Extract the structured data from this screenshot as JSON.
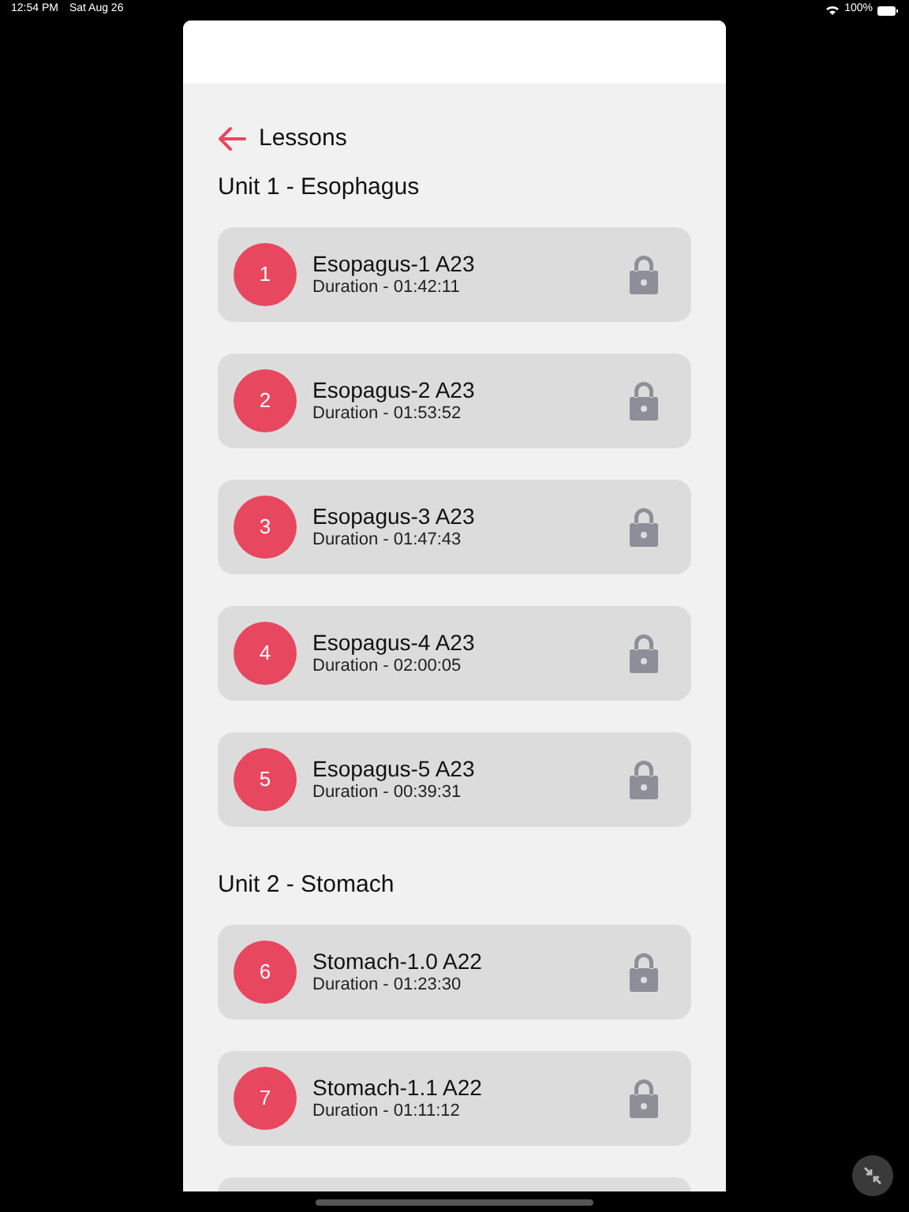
{
  "status_bar": {
    "time": "12:54 PM",
    "date": "Sat Aug 26",
    "battery": "100%"
  },
  "header": {
    "back_label": "Lessons"
  },
  "units": [
    {
      "title": "Unit 1 - Esophagus",
      "lessons": [
        {
          "number": "1",
          "title": "Esopagus-1 A23",
          "duration": "Duration - 01:42:11",
          "locked": true
        },
        {
          "number": "2",
          "title": "Esopagus-2 A23",
          "duration": "Duration - 01:53:52",
          "locked": true
        },
        {
          "number": "3",
          "title": "Esopagus-3 A23",
          "duration": "Duration - 01:47:43",
          "locked": true
        },
        {
          "number": "4",
          "title": "Esopagus-4 A23",
          "duration": "Duration - 02:00:05",
          "locked": true
        },
        {
          "number": "5",
          "title": "Esopagus-5 A23",
          "duration": "Duration - 00:39:31",
          "locked": true
        }
      ]
    },
    {
      "title": "Unit 2 - Stomach",
      "lessons": [
        {
          "number": "6",
          "title": "Stomach-1.0 A22",
          "duration": "Duration - 01:23:30",
          "locked": true
        },
        {
          "number": "7",
          "title": "Stomach-1.1 A22",
          "duration": "Duration - 01:11:12",
          "locked": true
        }
      ]
    }
  ]
}
